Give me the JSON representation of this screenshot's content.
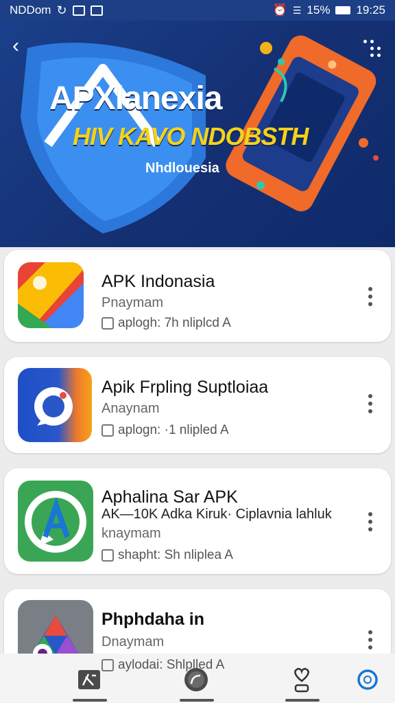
{
  "status_bar": {
    "carrier": "NDDom",
    "battery": "15%",
    "time": "19:25"
  },
  "hero": {
    "title": "APXlanexia",
    "subtitle": "HIV KAVO NDOBSTH",
    "tagline": "Nhdlouesia",
    "back_icon": "back-arrow-icon",
    "menu_icon": "more-dots-icon"
  },
  "apps": [
    {
      "name": "APK Indonasia",
      "developer": "Pnaymam",
      "meta": "aplogh:  7h nliplcd A"
    },
    {
      "name": "Apik Frpling Suptloiaa",
      "developer": "Anaynam",
      "meta": "aplogn:  ·1 nlipled A"
    },
    {
      "name": "Aphalina Sar APK",
      "description": "AK—10K Adka Kiruk· Ciplavnia lahluk",
      "developer": "knaymam",
      "meta": "shapht:  Sh nliplea A"
    },
    {
      "name": "Phphdaha in",
      "developer": "Dnaymam",
      "meta": "aylodai:  Shlplled A"
    }
  ],
  "bottom_nav": [
    {
      "icon": "apps-icon"
    },
    {
      "icon": "chat-icon"
    },
    {
      "icon": "profile-icon"
    },
    {
      "icon": "settings-icon"
    }
  ],
  "colors": {
    "hero_bg": "#1a3f8a",
    "title_yellow": "#f4d21a",
    "accent_blue": "#1976d2"
  }
}
